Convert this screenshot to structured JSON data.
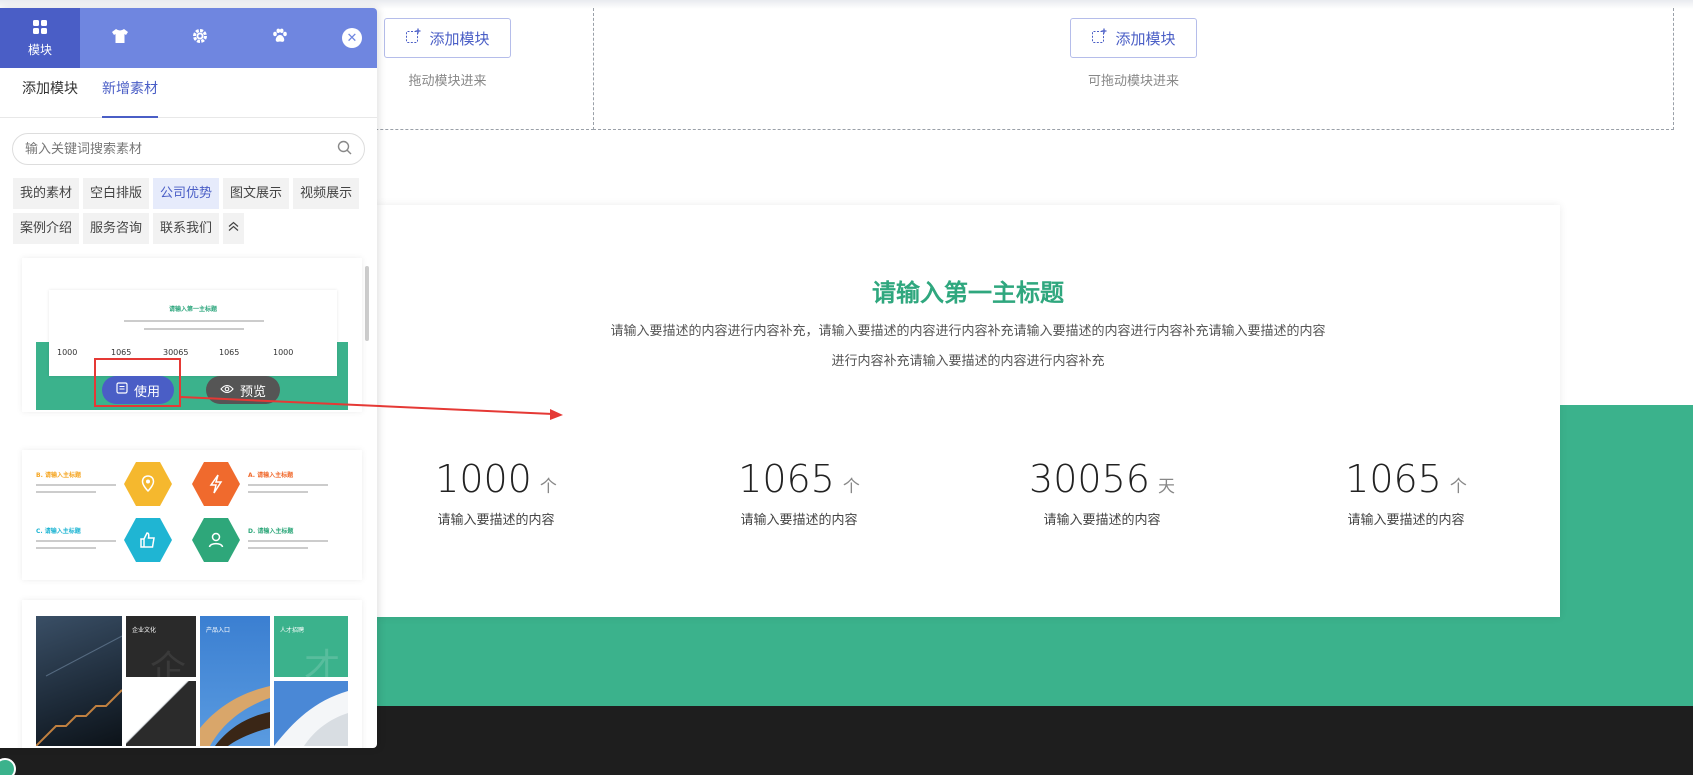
{
  "panel": {
    "tabs": [
      {
        "label": "模块",
        "icon": "grid-icon"
      },
      {
        "label": "",
        "icon": "shirt-icon"
      },
      {
        "label": "",
        "icon": "gear-icon"
      },
      {
        "label": "",
        "icon": "paw-icon"
      }
    ],
    "sub_tabs": [
      "添加模块",
      "新增素材"
    ],
    "active_sub_tab": "新增素材",
    "search": {
      "placeholder": "输入关键词搜索素材",
      "value": ""
    },
    "categories": [
      "我的素材",
      "空白排版",
      "公司优势",
      "图文展示",
      "视频展示",
      "案例介绍",
      "服务咨询",
      "联系我们"
    ],
    "active_category": "公司优势",
    "templates": {
      "t1": {
        "title": "请输入第一主标题",
        "numbers": [
          "1000",
          "1065",
          "30065",
          "1065",
          "1000"
        ],
        "use_label": "使用",
        "preview_label": "预览"
      },
      "t2": {
        "items": [
          {
            "letter": "B.",
            "title": "请输入主标题"
          },
          {
            "letter": "A.",
            "title": "请输入主标题"
          },
          {
            "letter": "C.",
            "title": "请输入主标题"
          },
          {
            "letter": "D.",
            "title": "请输入主标题"
          }
        ]
      },
      "t3": {
        "labels": [
          "企业文化",
          "产品入口",
          "人才招聘"
        ],
        "watermarks": [
          "企",
          "才"
        ]
      }
    }
  },
  "canvas": {
    "add_module_label": "添加模块",
    "drop_hint": "可拖动模块进来",
    "drop_hint_left": "拖动模块进来",
    "card": {
      "title": "请输入第一主标题",
      "description": "请输入要描述的内容进行内容补充，请输入要描述的内容进行内容补充请输入要描述的内容进行内容补充请输入要描述的内容进行内容补充请输入要描述的内容进行内容补充",
      "stats": [
        {
          "number": "1000",
          "unit": "个",
          "label": "请输入要描述的内容"
        },
        {
          "number": "1065",
          "unit": "个",
          "label": "请输入要描述的内容"
        },
        {
          "number": "30056",
          "unit": "天",
          "label": "请输入要描述的内容"
        },
        {
          "number": "1065",
          "unit": "个",
          "label": "请输入要描述的内容"
        }
      ]
    }
  },
  "colors": {
    "accent": "#4a5ec6",
    "panel_header": "#6f86e0",
    "green": "#3bb28c",
    "title_green": "#2fa77e",
    "annotation_red": "#e53935"
  }
}
